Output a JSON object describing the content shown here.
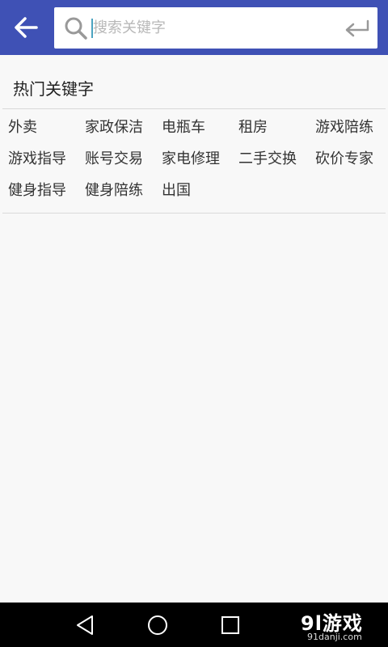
{
  "header": {
    "back_icon": "arrow-left-icon",
    "search_icon": "search-icon",
    "enter_icon": "enter-return-icon",
    "background_color": "#3f51b5",
    "search": {
      "placeholder": "搜索关键字",
      "value": ""
    }
  },
  "hot_keywords": {
    "title": "热门关键字",
    "rows": [
      [
        "外卖",
        "家政保洁",
        "电瓶车",
        "租房",
        "游戏陪练"
      ],
      [
        "游戏指导",
        "账号交易",
        "家电修理",
        "二手交换",
        "砍价专家"
      ],
      [
        "健身指导",
        "健身陪练",
        "出国"
      ]
    ]
  },
  "navbar": {
    "back_icon": "nav-back-icon",
    "home_icon": "nav-home-icon",
    "recents_icon": "nav-recents-icon"
  },
  "watermark": {
    "brand": "9l游戏",
    "url": "91danji.com"
  }
}
